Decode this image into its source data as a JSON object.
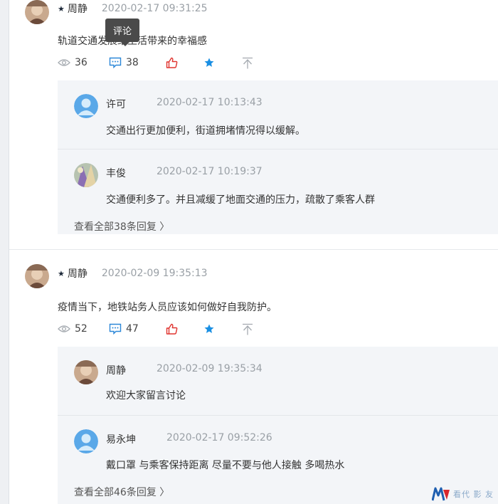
{
  "tooltip": "评论",
  "posts": [
    {
      "author": "周静",
      "time": "2020-02-17 09:31:25",
      "text": "轨道交通发展给生活带来的幸福感",
      "views": "36",
      "comments": "38",
      "replies": [
        {
          "name": "许可",
          "time": "2020-02-17 10:13:43",
          "text": "交通出行更加便利，街道拥堵情况得以缓解。"
        },
        {
          "name": "丰俊",
          "time": "2020-02-17 10:19:37",
          "text": "交通便利多了。并且减缓了地面交通的压力，疏散了乘客人群"
        }
      ],
      "view_all": "查看全部38条回复 〉"
    },
    {
      "author": "周静",
      "time": "2020-02-09 19:35:13",
      "text": "疫情当下，地铁站务人员应该如何做好自我防护。",
      "views": "52",
      "comments": "47",
      "replies": [
        {
          "name": "周静",
          "time": "2020-02-09 19:35:34",
          "text": "欢迎大家留言讨论"
        },
        {
          "name": "易永坤",
          "time": "2020-02-17 09:52:26",
          "text": "戴口罩 与乘客保持距离 尽量不要与他人接触  多喝热水"
        }
      ],
      "view_all": "查看全部46条回复 〉"
    }
  ],
  "watermark": "看代 影 友",
  "colors": {
    "like_red": "#e0332e",
    "star_blue": "#1a8fe3",
    "comment_blue": "#2b87d8",
    "reply_bg": "#f3f5f8",
    "time_gray": "#9aa0a6"
  },
  "icons": [
    "eye-icon",
    "comment-icon",
    "thumbs-up-icon",
    "star-icon",
    "pin-top-icon",
    "default-avatar-icon"
  ]
}
